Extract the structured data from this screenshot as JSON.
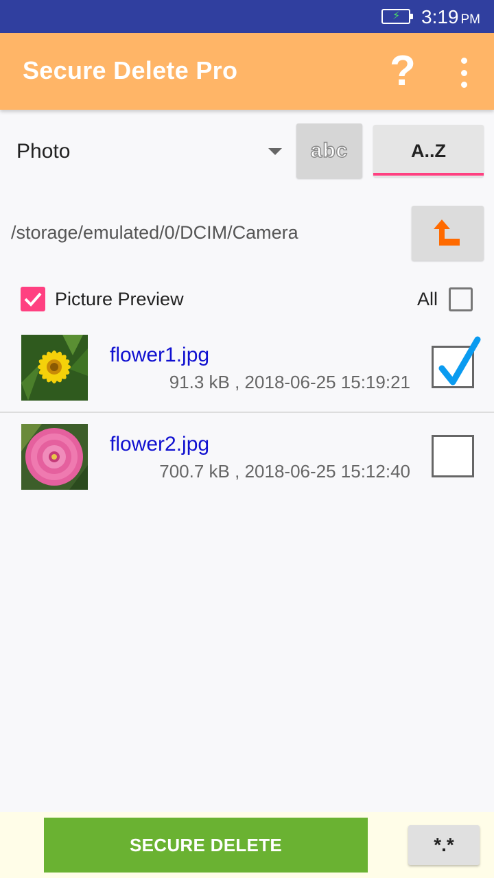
{
  "status_bar": {
    "time": "3:19",
    "ampm": "PM",
    "battery_state": "charging"
  },
  "app_bar": {
    "title": "Secure Delete Pro",
    "help_label": "?",
    "help_icon": "question-mark-icon",
    "overflow_icon": "more-vert-icon",
    "background_color": "#ffb567"
  },
  "controls": {
    "file_type": "Photo",
    "abc_label": "abc",
    "az_label": "A..Z",
    "accent_color": "#ff4081"
  },
  "path": {
    "current": "/storage/emulated/0/DCIM/Camera",
    "up_icon": "folder-up-arrow-icon"
  },
  "options": {
    "picture_preview_label": "Picture Preview",
    "picture_preview_checked": true,
    "all_label": "All",
    "all_checked": false
  },
  "files": [
    {
      "name": "flower1.jpg",
      "meta": "91.3 kB , 2018-06-25 15:19:21",
      "checked": true,
      "thumbnail": "yellow-flower"
    },
    {
      "name": "flower2.jpg",
      "meta": "700.7 kB , 2018-06-25 15:12:40",
      "checked": false,
      "thumbnail": "pink-flower"
    }
  ],
  "footer": {
    "delete_label": "SECURE DELETE",
    "wildcard_label": "*.*",
    "delete_color": "#6ab232"
  }
}
